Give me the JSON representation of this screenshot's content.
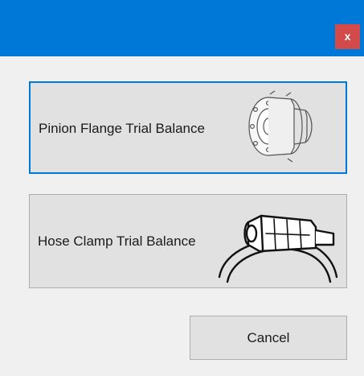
{
  "window": {
    "close_label": "x"
  },
  "options": [
    {
      "label": "Pinion Flange Trial Balance",
      "icon": "pinion-flange-icon"
    },
    {
      "label": "Hose Clamp Trial Balance",
      "icon": "hose-clamp-icon"
    }
  ],
  "footer": {
    "cancel_label": "Cancel"
  },
  "colors": {
    "titlebar": "#0078d7",
    "close": "#d24a4a",
    "button_face": "#e1e1e1",
    "focus_border": "#0078d7"
  }
}
